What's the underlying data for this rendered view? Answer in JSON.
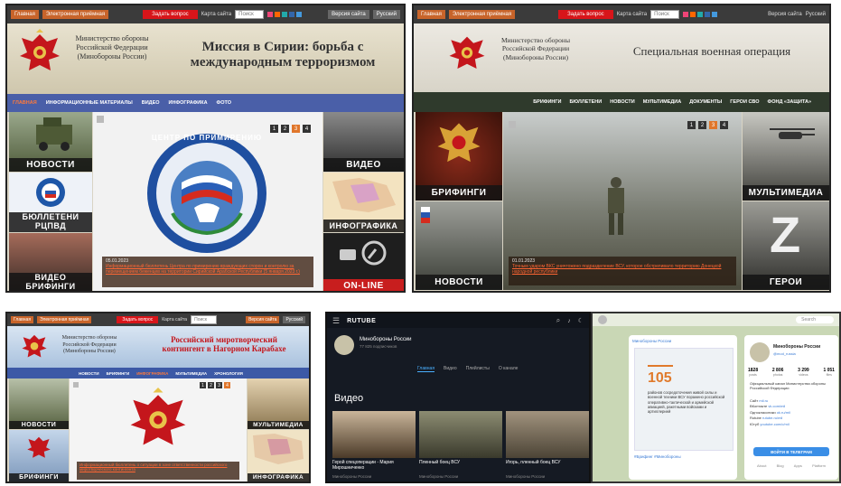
{
  "p1": {
    "top": {
      "home": "Главная",
      "ereception": "Электронная приёмная",
      "ask": "Задать вопрос",
      "sitemap": "Карта сайта",
      "search": "Поиск",
      "version": "Версия сайта",
      "lang": "Русский"
    },
    "min_name": [
      "Министерство обороны",
      "Российской Федерации",
      "(Минобороны России)"
    ],
    "title": [
      "Миссия в Сирии: борьба с",
      "международным терроризмом"
    ],
    "nav": [
      "ГЛАВНАЯ",
      "ИНФОРМАЦИОННЫЕ МАТЕРИАЛЫ",
      "ВИДЕО",
      "ИНФОГРАФИКА",
      "ФОТО"
    ],
    "left_tiles": [
      "НОВОСТИ",
      "БЮЛЛЕТЕНИ РЦПВД",
      "ВИДЕО БРИФИНГИ"
    ],
    "right_tiles": [
      "ВИДЕО",
      "ИНФОГРАФИКА",
      "ON-LINE"
    ],
    "center_emblem": "ЦЕНТР ПО ПРИМИРЕНИЮ",
    "pager": [
      "1",
      "2",
      "3",
      "4"
    ],
    "caption_date": "05.01.2023",
    "caption_text": "Информационный бюллетень Центра по примирению враждующих сторон и контролю за перемещением беженцев на территории Сирийской Арабской Республики (5 января 2023 г.)"
  },
  "p2": {
    "top": {
      "home": "Главная",
      "ereception": "Электронная приёмная",
      "ask": "Задать вопрос",
      "sitemap": "Карта сайта",
      "search": "Поиск",
      "version": "Версия сайта",
      "lang": "Русский"
    },
    "min_name": [
      "Министерство обороны",
      "Российской Федерации",
      "(Минобороны России)"
    ],
    "title": "Специальная военная операция",
    "nav": [
      "БРИФИНГИ",
      "БЮЛЛЕТЕНИ",
      "НОВОСТИ",
      "МУЛЬТИМЕДИА",
      "ДОКУМЕНТЫ",
      "ГЕРОИ СВО",
      "ФОНД «ЗАЩИТА»"
    ],
    "left_tiles": [
      "БРИФИНГИ",
      "НОВОСТИ"
    ],
    "right_tiles": [
      "МУЛЬТИМЕДИА",
      "ГЕРОИ"
    ],
    "pager": [
      "1",
      "2",
      "3",
      "4"
    ],
    "caption_date": "01.01.2023",
    "caption_text": "Точным ударом ВКС уничтожено подразделение ВСУ, которое обстреливало территорию Донецкой народной республики"
  },
  "p3": {
    "top": {
      "home": "Главная",
      "ereception": "Электронная приёмная",
      "ask": "Задать вопрос",
      "sitemap": "Карта сайта",
      "search": "Поиск",
      "version": "Версия сайта",
      "lang": "Русский"
    },
    "min_name": [
      "Министерство обороны",
      "Российской Федерации",
      "(Минобороны России)"
    ],
    "title": [
      "Российский миротворческий",
      "контингент в Нагорном Карабахе"
    ],
    "nav": [
      "НОВОСТИ",
      "БРИФИНГИ",
      "ИНФОГРАФИКА",
      "МУЛЬТИМЕДИА",
      "ХРОНОЛОГИЯ"
    ],
    "left_tiles": [
      "НОВОСТИ",
      "БРИФИНГИ"
    ],
    "right_tiles": [
      "МУЛЬТИМЕДИА",
      "ИНФОГРАФИКА"
    ],
    "pager": [
      "1",
      "2",
      "3",
      "4"
    ],
    "caption_text": "Информационный бюллетень о ситуации в зоне ответственности российского миротворческого контингента"
  },
  "p4": {
    "logo": "RUTUBE",
    "channel": "Минобороны России",
    "subs": "77 825 подписчиков",
    "tabs": [
      "Главная",
      "Видео",
      "Плейлисты",
      "О канале"
    ],
    "section": "Видео",
    "videos": [
      {
        "title": "Герой спецоперации - Мария Мирошниченко",
        "author": "Минобороны России"
      },
      {
        "title": "Пленный боец ВСУ",
        "author": "Минобороны России"
      },
      {
        "title": "Игорь, пленный боец ВСУ",
        "author": "Минобороны России"
      }
    ]
  },
  "p5": {
    "search": "Search",
    "channel_label": "Минобороны России",
    "post_number": "105",
    "post_text": "районов сосредоточения живой силы и военной техники ВСУ поражено российской оперативно-тактической и армейской авиацией, ракетными войсками и артиллерией",
    "tag": "#Брифинг #Минобороны",
    "profile": {
      "name": "Минобороны России",
      "handle": "@mod_russia",
      "stats": [
        {
          "v": "1828",
          "l": "posts"
        },
        {
          "v": "2 806",
          "l": "photos"
        },
        {
          "v": "3 299",
          "l": "videos"
        },
        {
          "v": "1 051",
          "l": "files"
        }
      ],
      "desc": "Официальный канал Министерства обороны Российской Федерации",
      "links": [
        {
          "k": "Сайт",
          "v": "mil.ru"
        },
        {
          "k": "ВКонтакте",
          "v": "vk.com/mil"
        },
        {
          "k": "Одноклассники",
          "v": "ok.ru/mil"
        },
        {
          "k": "Rutube",
          "v": "rutube.ru/mil"
        },
        {
          "k": "Ютуб",
          "v": "youtube.com/c/mil"
        }
      ],
      "button": "ВОЙТИ В ТЕЛЕГРАМ",
      "footer": [
        "About",
        "Blog",
        "Apps",
        "Platform"
      ]
    }
  }
}
